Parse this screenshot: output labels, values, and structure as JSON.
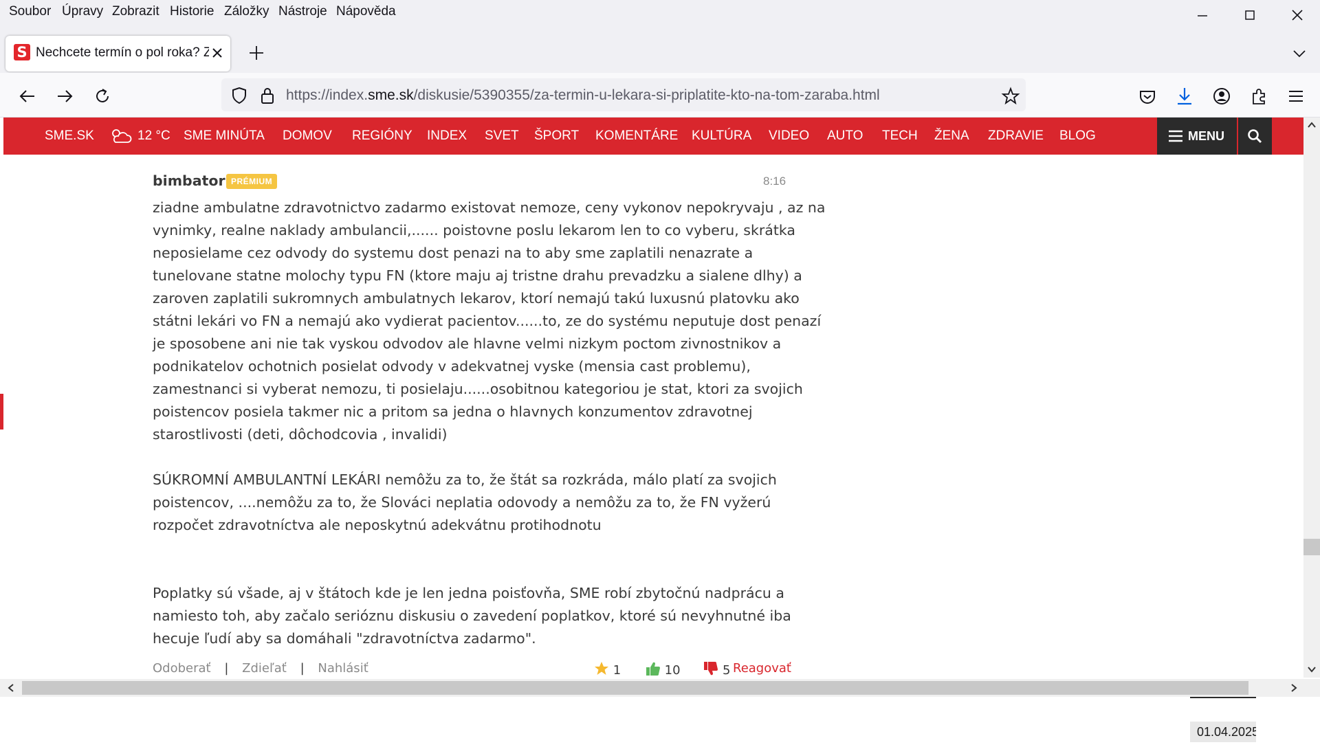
{
  "menubar": {
    "items": [
      "Soubor",
      "Úpravy",
      "Zobrazit",
      "Historie",
      "Záložky",
      "Nástroje",
      "Nápověda"
    ]
  },
  "tab": {
    "favicon": "S",
    "title": "Nechcete termín o pol roka? Zap"
  },
  "urlbar": {
    "prefix": "https://index.",
    "host": "sme.sk",
    "path": "/diskusie/5390355/za-termin-u-lekara-si-priplatite-kto-na-tom-zaraba.html"
  },
  "site_nav": {
    "items": [
      "SME.SK",
      "12 °C",
      "SME MINÚTA",
      "DOMOV",
      "REGIÓNY",
      "INDEX",
      "SVET",
      "ŠPORT",
      "KOMENTÁRE",
      "KULTÚRA",
      "VIDEO",
      "AUTO",
      "TECH",
      "ŽENA",
      "ZDRAVIE",
      "BLOG"
    ],
    "menu_label": "MENU"
  },
  "comment": {
    "author": "bimbator",
    "badge": "PRÉMIUM",
    "time": "8:16",
    "lines": [
      "ziadne ambulatne zdravotnictvo zadarmo existovat nemoze, ceny vykonov nepokryvaju , az na",
      "vynimky, realne naklady ambulancii,...... poistovne poslu lekarom len to co vyberu, skrátka",
      "neposielame cez odvody do systemu dost penazi na to aby sme zaplatili nenazrate a",
      "tunelovane statne molochy typu FN (ktore maju aj tristne drahu prevadzku a sialene dlhy) a",
      "zaroven zaplatili sukromnych ambulatnych lekarov, ktorí nemajú takú luxusnú platovku ako",
      "státni lekári vo FN a nemajú ako vydierat pacientov......to, ze do systému neputuje dost penazí",
      "je sposobene ani nie tak vyskou odvodov ale hlavne velmi nizkym poctom zivnostnikov a",
      "podnikatelov ochotnich posielat odvody v adekvatnej vyske (mensia cast problemu),",
      "zamestnanci si vyberat nemozu, ti posielaju......osobitnou kategoriou je stat, ktori za svojich",
      "poistencov posiela takmer nic a pritom sa jedna o hlavnych konzumentov zdravotnej",
      "starostlivosti (deti, dôchodcovia , invalidi)",
      "",
      "SÚKROMNÍ AMBULANTNÍ LEKÁRI nemôžu za to, že štát sa rozkráda, málo platí za svojich",
      "poistencov, ....nemôžu za to, že Slováci neplatia odovody a nemôžu za to, že FN vyžerú",
      "rozpočet zdravotníctva ale neposkytnú adekvátnu protihodnotu",
      "",
      "",
      "Poplatky sú všade, aj v štátoch kde je len jedna poisťovňa, SME robí zbytočnú nadprácu a",
      "namiesto toh, aby začalo serióznu diskusiu o zavedení poplatkov, ktoré sú nevyhnutné iba",
      "hecuje ľudí aby sa domáhali \"zdravotníctva zadarmo\"."
    ],
    "actions": {
      "unsubscribe": "Odoberať",
      "share": "Zdieľať",
      "report": "Nahlásiť",
      "separator": "|",
      "stars": "1",
      "likes": "10",
      "dislikes": "5",
      "reply": "Reagovať"
    }
  },
  "taskbar": {
    "date": "01.04.2025"
  },
  "colors": {
    "brand_red": "#d9262d",
    "premium_badge": "#f5c542",
    "link_gray": "#8a8a8a",
    "reply_red": "#d9262d",
    "like_green": "#5cb85c"
  }
}
